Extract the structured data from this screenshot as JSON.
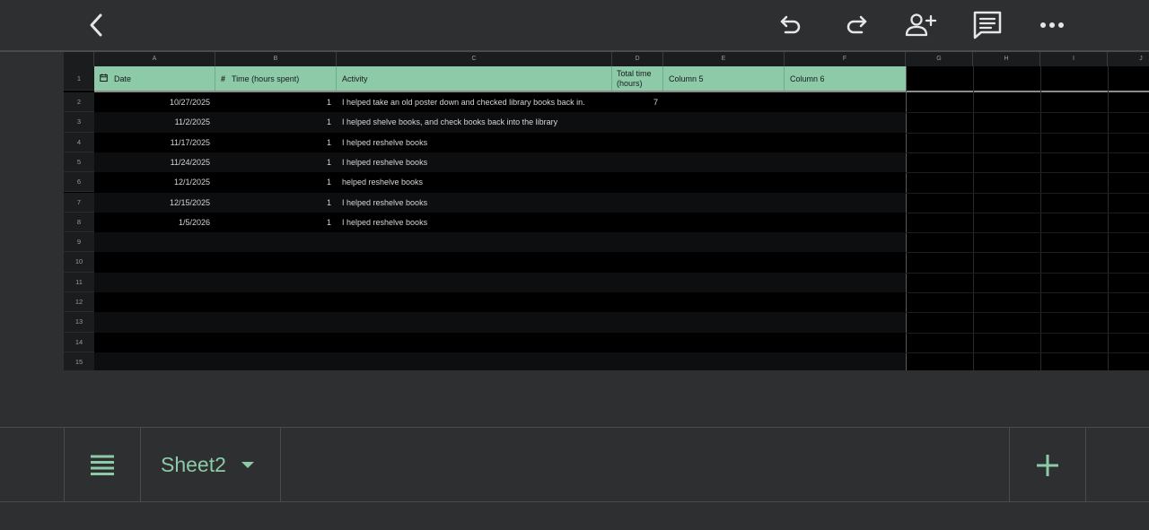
{
  "toolbar": {
    "icons": [
      "back-icon",
      "undo-icon",
      "redo-icon",
      "share-icon",
      "comment-icon",
      "more-icon"
    ],
    "icon_color": "#e6e6e6"
  },
  "columns": [
    "A",
    "B",
    "C",
    "D",
    "E",
    "F",
    "G",
    "H",
    "I",
    "J"
  ],
  "header": {
    "date": "Date",
    "time": "Time (hours spent)",
    "activity": "Activity",
    "total_line1": "Total time",
    "total_line2": "(hours)",
    "col5": "Column 5",
    "col6": "Column 6",
    "date_icon": "calendar-icon",
    "time_icon": "#"
  },
  "rows": [
    {
      "num": "2",
      "date": "10/27/2025",
      "time": "1",
      "activity": "I helped take an old poster down and checked library books back in.",
      "total": "7"
    },
    {
      "num": "3",
      "date": "11/2/2025",
      "time": "1",
      "activity": "I helped shelve books, and check books back into the library",
      "total": ""
    },
    {
      "num": "4",
      "date": "11/17/2025",
      "time": "1",
      "activity": "I helped reshelve books",
      "total": ""
    },
    {
      "num": "5",
      "date": "11/24/2025",
      "time": "1",
      "activity": "I helped reshelve books",
      "total": ""
    },
    {
      "num": "6",
      "date": "12/1/2025",
      "time": "1",
      "activity": " helped reshelve books",
      "total": ""
    },
    {
      "num": "7",
      "date": "12/15/2025",
      "time": "1",
      "activity": "I helped reshelve books",
      "total": ""
    },
    {
      "num": "8",
      "date": "1/5/2026",
      "time": "1",
      "activity": "I helped reshelve books",
      "total": ""
    },
    {
      "num": "9",
      "date": "",
      "time": "",
      "activity": "",
      "total": ""
    },
    {
      "num": "10",
      "date": "",
      "time": "",
      "activity": "",
      "total": ""
    },
    {
      "num": "11",
      "date": "",
      "time": "",
      "activity": "",
      "total": ""
    },
    {
      "num": "12",
      "date": "",
      "time": "",
      "activity": "",
      "total": ""
    },
    {
      "num": "13",
      "date": "",
      "time": "",
      "activity": "",
      "total": ""
    },
    {
      "num": "14",
      "date": "",
      "time": "",
      "activity": "",
      "total": ""
    },
    {
      "num": "15",
      "date": "",
      "time": "",
      "activity": "",
      "total": ""
    }
  ],
  "header_row_num": "1",
  "sheet_tab": {
    "name": "Sheet2"
  },
  "colors": {
    "accent": "#8ccaa8",
    "background": "#2e2f31",
    "grid": "#000000",
    "row_alt": "#0d0e0f"
  }
}
